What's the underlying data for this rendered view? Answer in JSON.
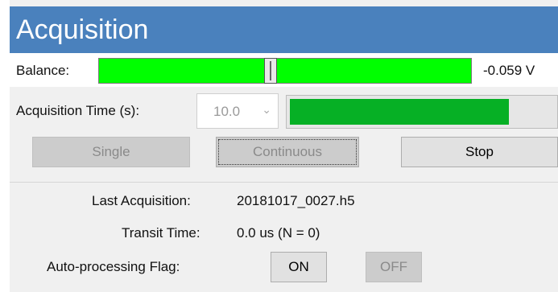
{
  "header": {
    "title": "Acquisition"
  },
  "balance": {
    "label": "Balance:",
    "value_text": "-0.059  V",
    "slider_fraction": 0.46
  },
  "acquisition_time": {
    "label": "Acquisition Time (s):",
    "selected": "10.0",
    "progress_fraction": 0.83
  },
  "buttons": {
    "single": "Single",
    "continuous": "Continuous",
    "stop": "Stop"
  },
  "info": {
    "last_acq_label": "Last Acquisition:",
    "last_acq_value": "20181017_0027.h5",
    "transit_label": "Transit Time:",
    "transit_value": "0.0 us (N = 0)",
    "flag_label": "Auto-processing Flag:",
    "on_label": "ON",
    "off_label": "OFF"
  },
  "colors": {
    "header": "#4a81bd",
    "slider": "#00ff00",
    "progress": "#06b025"
  },
  "icons": {
    "select_chevron": "chevron-down-icon"
  }
}
